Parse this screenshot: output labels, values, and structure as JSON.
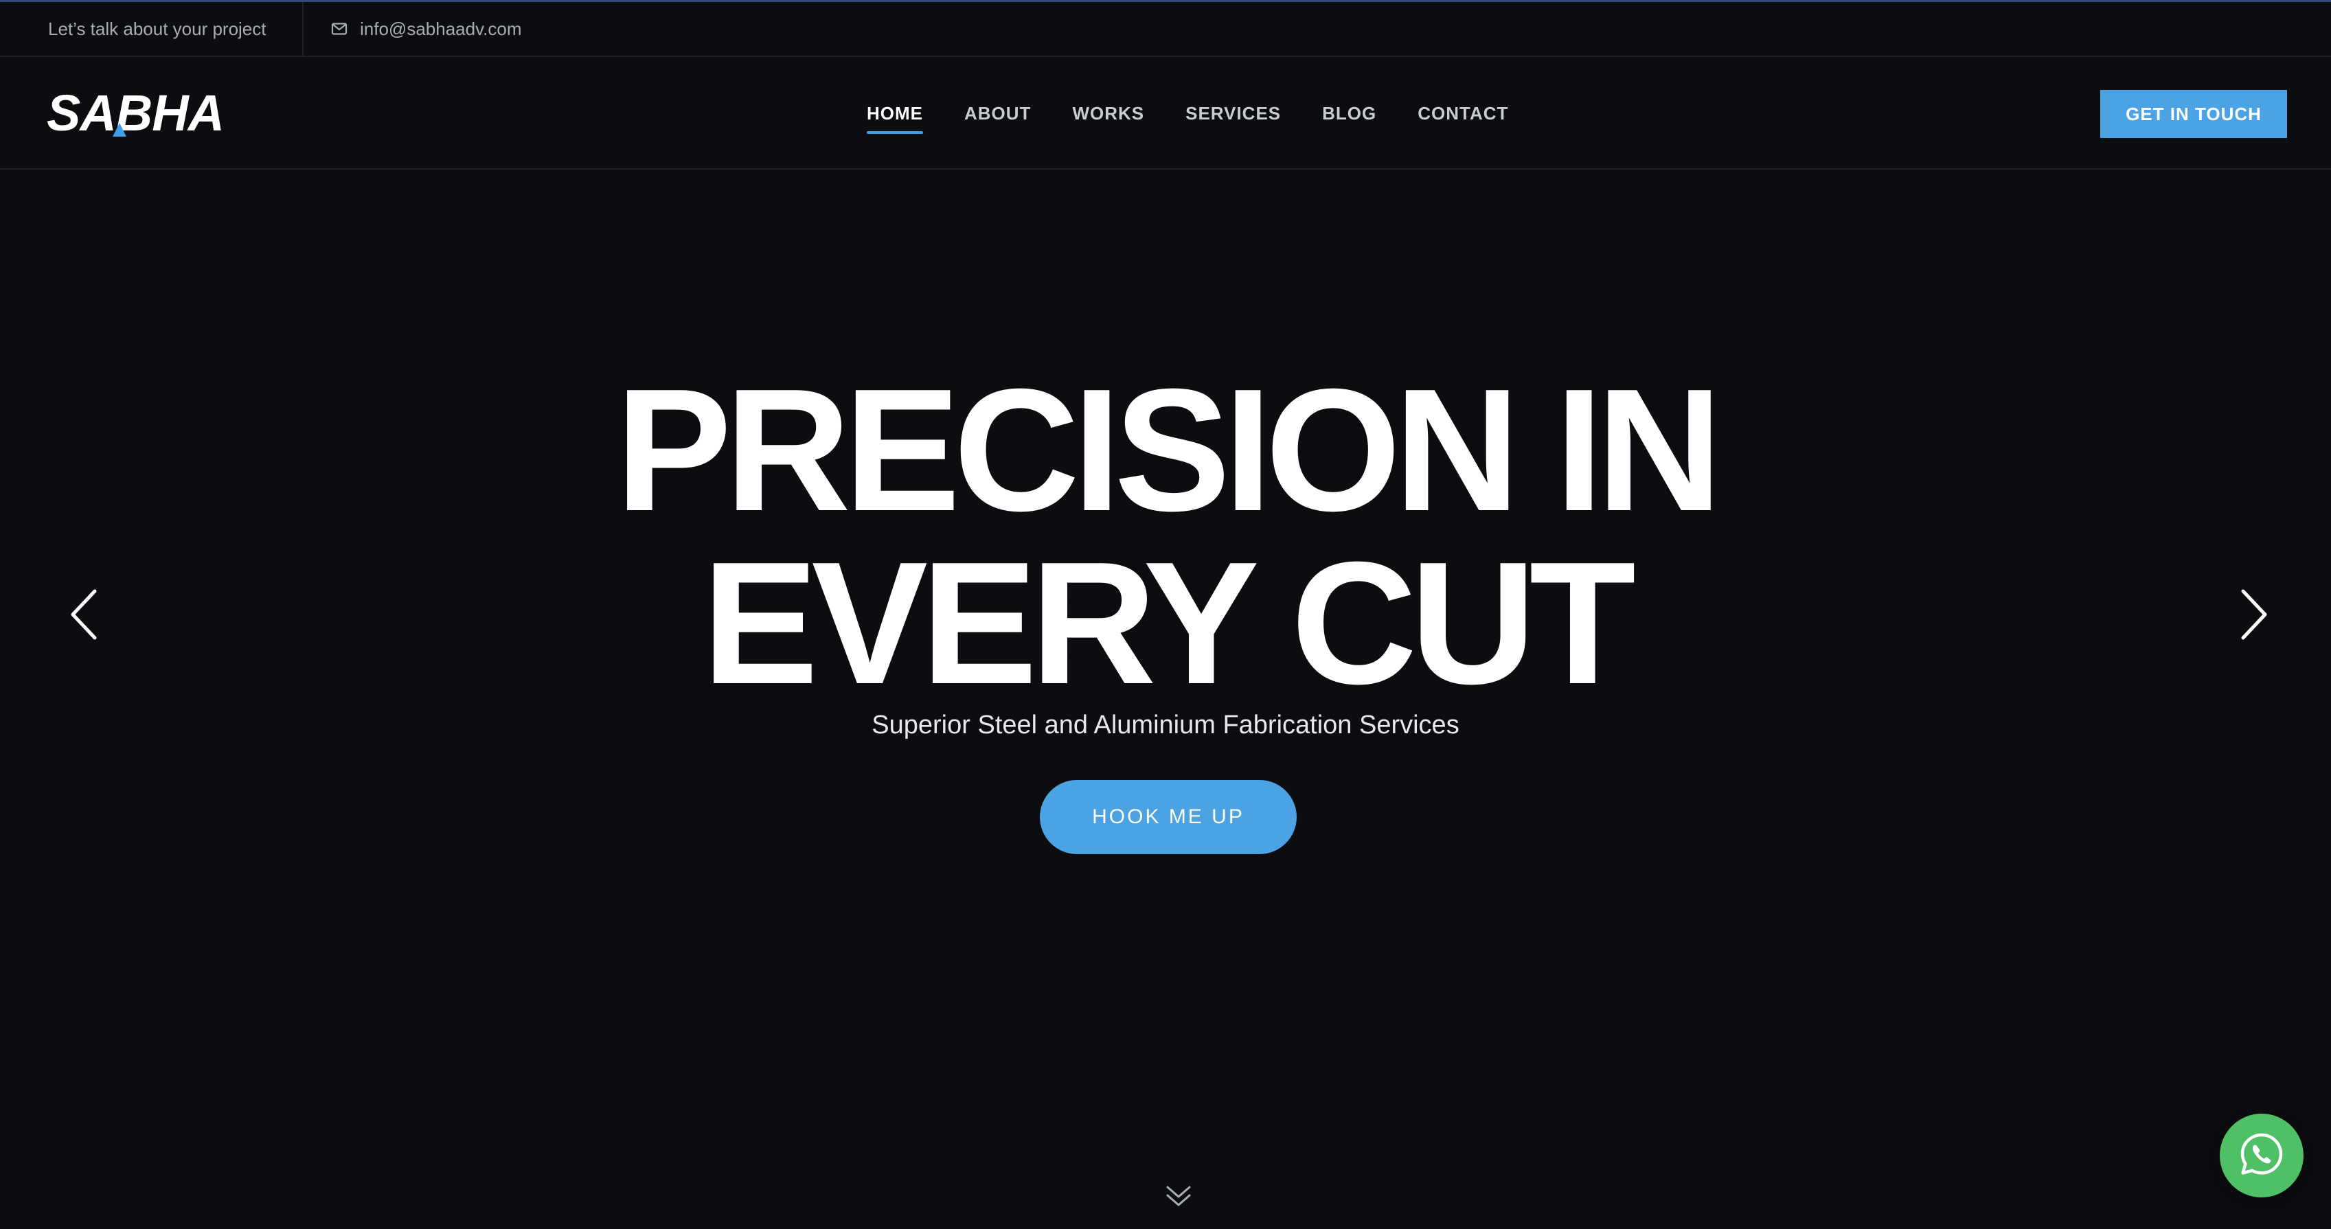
{
  "topbar": {
    "tagline": "Let’s talk about your project",
    "email": "info@sabhaadv.com",
    "email_icon": "envelope-icon"
  },
  "header": {
    "logo_text": "SABHA",
    "nav": [
      {
        "label": "HOME",
        "active": true
      },
      {
        "label": "ABOUT",
        "active": false
      },
      {
        "label": "WORKS",
        "active": false
      },
      {
        "label": "SERVICES",
        "active": false
      },
      {
        "label": "BLOG",
        "active": false
      },
      {
        "label": "CONTACT",
        "active": false
      }
    ],
    "cta_label": "GET IN TOUCH"
  },
  "hero": {
    "title_line1": "PRECISION IN",
    "title_line2": "EVERY CUT",
    "subtitle": "Superior Steel and Aluminium Fabrication Services",
    "cta_label": "HOOK ME UP",
    "prev_icon": "chevron-left-icon",
    "next_icon": "chevron-right-icon",
    "scroll_icon": "double-chevron-down-icon"
  },
  "floating": {
    "whatsapp_icon": "whatsapp-icon"
  },
  "colors": {
    "background": "#0b0d10",
    "accent": "#4ba3e3",
    "whatsapp": "#4fc065",
    "text_muted": "#a9adb3"
  }
}
